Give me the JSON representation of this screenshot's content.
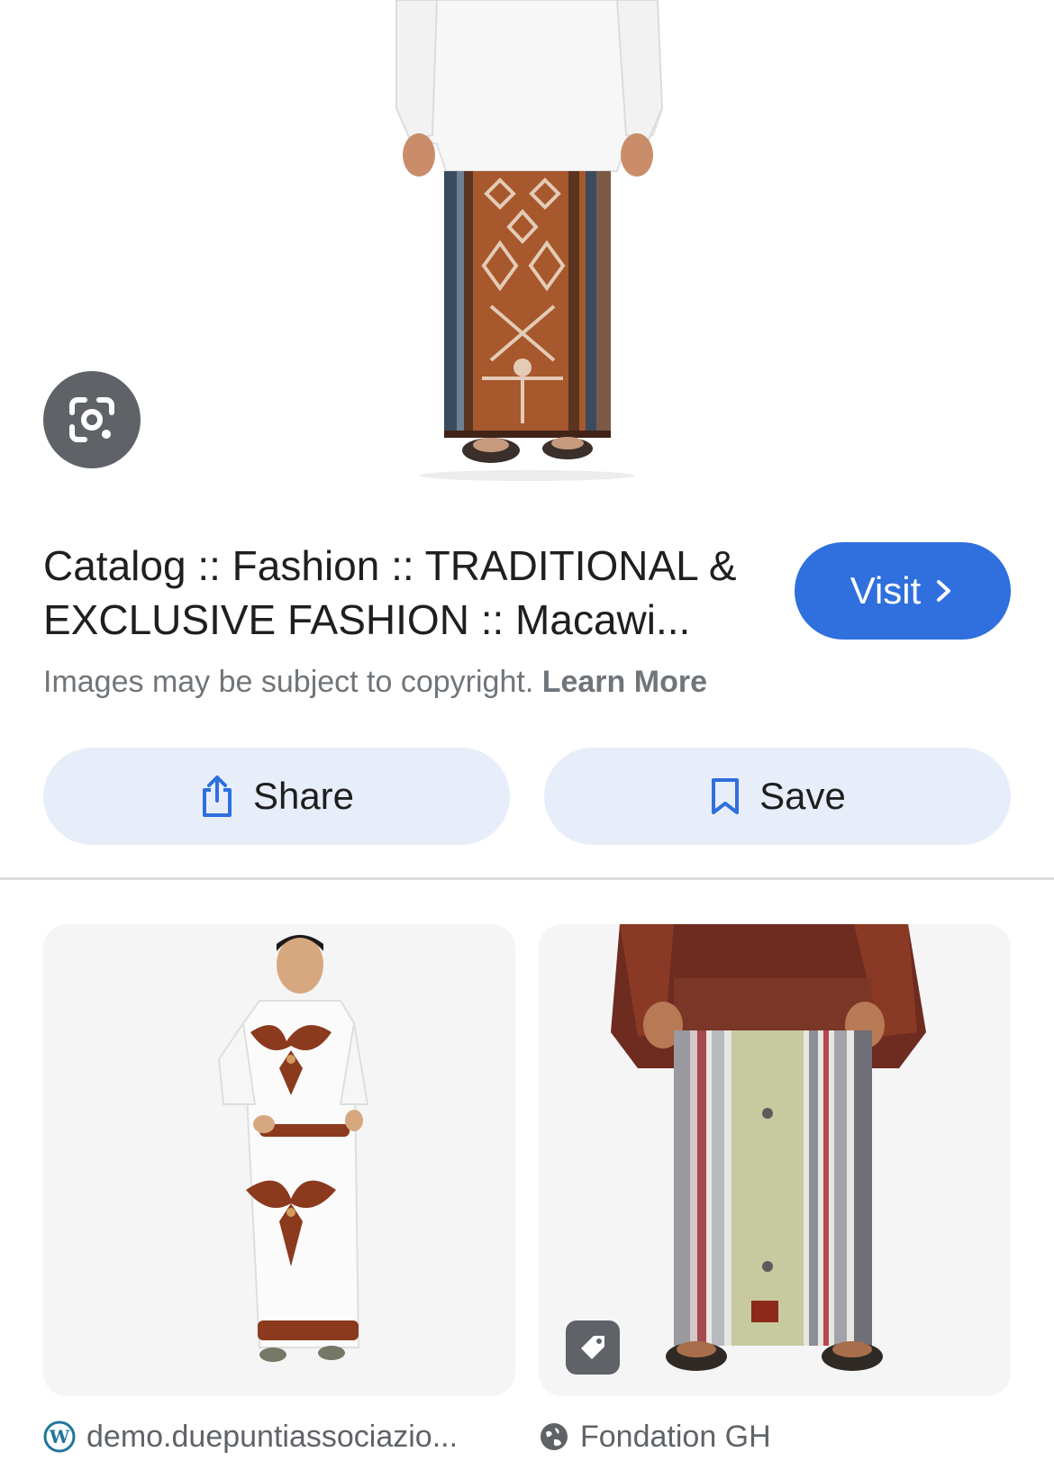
{
  "hero": {
    "image_alt": "Man in white shirt wearing brown patterned sarong",
    "lens_icon": "google-lens-icon"
  },
  "result": {
    "title": "Catalog :: Fashion :: TRADITIONAL & EXCLUSIVE FASHION :: Macawi...",
    "visit_label": "Visit",
    "copyright_text": "Images may be subject to copyright.",
    "learn_more_label": "Learn More"
  },
  "actions": {
    "share_label": "Share",
    "save_label": "Save"
  },
  "related": [
    {
      "source": "demo.duepuntiassociazio...",
      "favicon": "wordpress-icon"
    },
    {
      "source": "Fondation GH",
      "favicon": "globe-icon",
      "badge": "tag-icon"
    }
  ],
  "colors": {
    "accent": "#2f6fde",
    "button_bg": "#e8eef9",
    "icon_blue": "#2f6fde",
    "muted_text": "#70757a"
  }
}
